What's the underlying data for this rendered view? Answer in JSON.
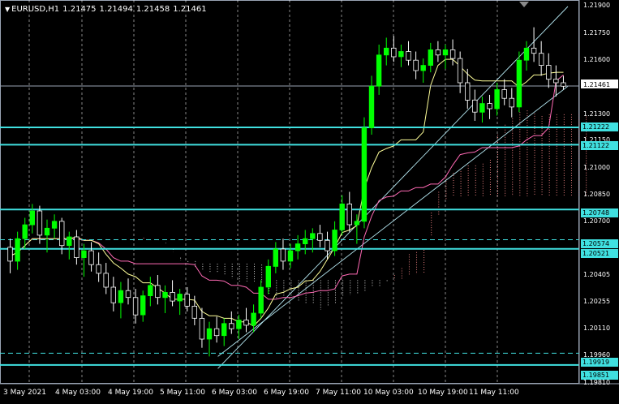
{
  "header": {
    "symbol": "EURUSD,H1",
    "open": "1.21475",
    "high": "1.21494",
    "low": "1.21458",
    "close": "1.21461"
  },
  "colors": {
    "background": "#000000",
    "bull_candle": "#00ff00",
    "bear_candle": "#ffffff",
    "hline": "#40e0e0",
    "current_price_line": "#9aa4b4",
    "kijun": "#ff69b4",
    "tenkan": "#ffff99",
    "cloud_bull": "#ff8c8c",
    "cloud_bear": "#e8e8e8",
    "channel": "#b4e6f0",
    "grid": "#ffffff"
  },
  "price_axis": {
    "ticks": [
      "1.21900",
      "1.21750",
      "1.21600",
      "1.21300",
      "1.21150",
      "1.21000",
      "1.20850",
      "1.20700",
      "1.20405",
      "1.20255",
      "1.20110",
      "1.19960",
      "1.19810"
    ]
  },
  "price_tags": {
    "current": "1.21461",
    "levels": [
      "1.21222",
      "1.21122",
      "1.20748",
      "1.20574",
      "1.20521",
      "1.19919",
      "1.19851"
    ]
  },
  "time_axis": {
    "labels": [
      "3 May 2021",
      "4 May 03:00",
      "4 May 19:00",
      "5 May 11:00",
      "6 May 03:00",
      "6 May 19:00",
      "7 May 11:00",
      "10 May 03:00",
      "10 May 19:00",
      "11 May 11:00"
    ]
  },
  "chart_data": {
    "type": "candlestick",
    "symbol": "EURUSD",
    "timeframe": "H1",
    "ylim": [
      1.1978,
      1.2192
    ],
    "grid": true,
    "current_price": 1.21461,
    "horizontal_levels": [
      {
        "value": 1.21222,
        "style": "solid"
      },
      {
        "value": 1.21122,
        "style": "solid"
      },
      {
        "value": 1.20748,
        "style": "solid"
      },
      {
        "value": 1.20574,
        "style": "dashed"
      },
      {
        "value": 1.20521,
        "style": "solid"
      },
      {
        "value": 1.19919,
        "style": "dashed"
      },
      {
        "value": 1.19851,
        "style": "solid"
      }
    ],
    "channel_lines": [
      {
        "from": [
          84,
          1.1983
        ],
        "to": [
          183,
          1.2192
        ]
      },
      {
        "from": [
          84,
          1.199
        ],
        "to": [
          183,
          1.2146
        ]
      }
    ],
    "ohlc": [
      [
        1.2053,
        1.2058,
        1.2038,
        1.2045
      ],
      [
        1.2045,
        1.2062,
        1.204,
        1.2058
      ],
      [
        1.2058,
        1.207,
        1.2052,
        1.2066
      ],
      [
        1.2066,
        1.2078,
        1.2061,
        1.2074
      ],
      [
        1.2074,
        1.2077,
        1.2055,
        1.206
      ],
      [
        1.206,
        1.2069,
        1.205,
        1.2064
      ],
      [
        1.2064,
        1.2072,
        1.2058,
        1.2068
      ],
      [
        1.2068,
        1.207,
        1.2049,
        1.2054
      ],
      [
        1.2054,
        1.2062,
        1.2046,
        1.2059
      ],
      [
        1.2059,
        1.2063,
        1.2043,
        1.2047
      ],
      [
        1.2047,
        1.2055,
        1.2036,
        1.2051
      ],
      [
        1.2051,
        1.2056,
        1.2039,
        1.2043
      ],
      [
        1.2043,
        1.205,
        1.2033,
        1.2038
      ],
      [
        1.2038,
        1.2044,
        1.2026,
        1.203
      ],
      [
        1.203,
        1.2036,
        1.2016,
        1.2021
      ],
      [
        1.2021,
        1.2033,
        1.2012,
        1.2028
      ],
      [
        1.2028,
        1.2035,
        1.202,
        1.2024
      ],
      [
        1.2024,
        1.2029,
        1.2009,
        1.2014
      ],
      [
        1.2014,
        1.2028,
        1.201,
        1.2025
      ],
      [
        1.2025,
        1.2036,
        1.2019,
        1.2031
      ],
      [
        1.2031,
        1.2037,
        1.202,
        1.2024
      ],
      [
        1.2024,
        1.2031,
        1.2015,
        1.2027
      ],
      [
        1.2027,
        1.2034,
        1.2019,
        1.2022
      ],
      [
        1.2022,
        1.2029,
        1.2014,
        1.2026
      ],
      [
        1.2026,
        1.203,
        1.2016,
        1.2019
      ],
      [
        1.2019,
        1.2025,
        1.2008,
        1.2012
      ],
      [
        1.2012,
        1.2018,
        1.1995,
        1.2
      ],
      [
        1.2,
        1.201,
        1.199,
        1.2006
      ],
      [
        1.2006,
        1.2013,
        1.1998,
        1.2002
      ],
      [
        1.2002,
        1.2012,
        1.1996,
        1.2009
      ],
      [
        1.2009,
        1.2016,
        1.2003,
        1.2006
      ],
      [
        1.2006,
        1.2014,
        1.2,
        1.2011
      ],
      [
        1.2011,
        1.2018,
        1.2004,
        1.2008
      ],
      [
        1.2008,
        1.202,
        1.2004,
        1.2015
      ],
      [
        1.2015,
        1.2034,
        1.2012,
        1.203
      ],
      [
        1.203,
        1.2046,
        1.2026,
        1.2042
      ],
      [
        1.2042,
        1.2056,
        1.2038,
        1.2052
      ],
      [
        1.2052,
        1.2058,
        1.204,
        1.2045
      ],
      [
        1.2045,
        1.2055,
        1.2041,
        1.2051
      ],
      [
        1.2051,
        1.206,
        1.2046,
        1.2055
      ],
      [
        1.2055,
        1.2063,
        1.2049,
        1.2058
      ],
      [
        1.2058,
        1.2064,
        1.205,
        1.2061
      ],
      [
        1.2061,
        1.2066,
        1.2053,
        1.2057
      ],
      [
        1.2057,
        1.2062,
        1.2046,
        1.2051
      ],
      [
        1.2051,
        1.2068,
        1.2048,
        1.2063
      ],
      [
        1.2063,
        1.2083,
        1.206,
        1.2078
      ],
      [
        1.2078,
        1.2085,
        1.2062,
        1.2066
      ],
      [
        1.2066,
        1.2072,
        1.2055,
        1.2068
      ],
      [
        1.2068,
        1.2128,
        1.2064,
        1.2122
      ],
      [
        1.2122,
        1.2152,
        1.2118,
        1.2146
      ],
      [
        1.2146,
        1.217,
        1.2141,
        1.2164
      ],
      [
        1.2164,
        1.2174,
        1.2158,
        1.2168
      ],
      [
        1.2168,
        1.2175,
        1.216,
        1.2163
      ],
      [
        1.2163,
        1.217,
        1.2157,
        1.2166
      ],
      [
        1.2166,
        1.2172,
        1.2158,
        1.2161
      ],
      [
        1.2161,
        1.2166,
        1.215,
        1.2155
      ],
      [
        1.2155,
        1.2162,
        1.2148,
        1.2158
      ],
      [
        1.2158,
        1.2171,
        1.2154,
        1.2167
      ],
      [
        1.2167,
        1.2172,
        1.216,
        1.2164
      ],
      [
        1.2164,
        1.217,
        1.2156,
        1.2167
      ],
      [
        1.2167,
        1.2173,
        1.2158,
        1.2162
      ],
      [
        1.2162,
        1.2166,
        1.2142,
        1.2148
      ],
      [
        1.2148,
        1.2156,
        1.2133,
        1.2138
      ],
      [
        1.2138,
        1.2144,
        1.2126,
        1.2131
      ],
      [
        1.2131,
        1.214,
        1.2125,
        1.2136
      ],
      [
        1.2136,
        1.2141,
        1.2127,
        1.2133
      ],
      [
        1.2133,
        1.2148,
        1.2129,
        1.2144
      ],
      [
        1.2144,
        1.215,
        1.2135,
        1.2139
      ],
      [
        1.2139,
        1.2145,
        1.2128,
        1.2134
      ],
      [
        1.2134,
        1.2166,
        1.2131,
        1.2161
      ],
      [
        1.2161,
        1.2172,
        1.2155,
        1.2168
      ],
      [
        1.2168,
        1.218,
        1.216,
        1.2165
      ],
      [
        1.2165,
        1.2172,
        1.2152,
        1.2158
      ],
      [
        1.2158,
        1.2165,
        1.2145,
        1.215
      ],
      [
        1.215,
        1.2158,
        1.214,
        1.2148
      ],
      [
        1.2148,
        1.2152,
        1.2144,
        1.2146
      ]
    ]
  }
}
